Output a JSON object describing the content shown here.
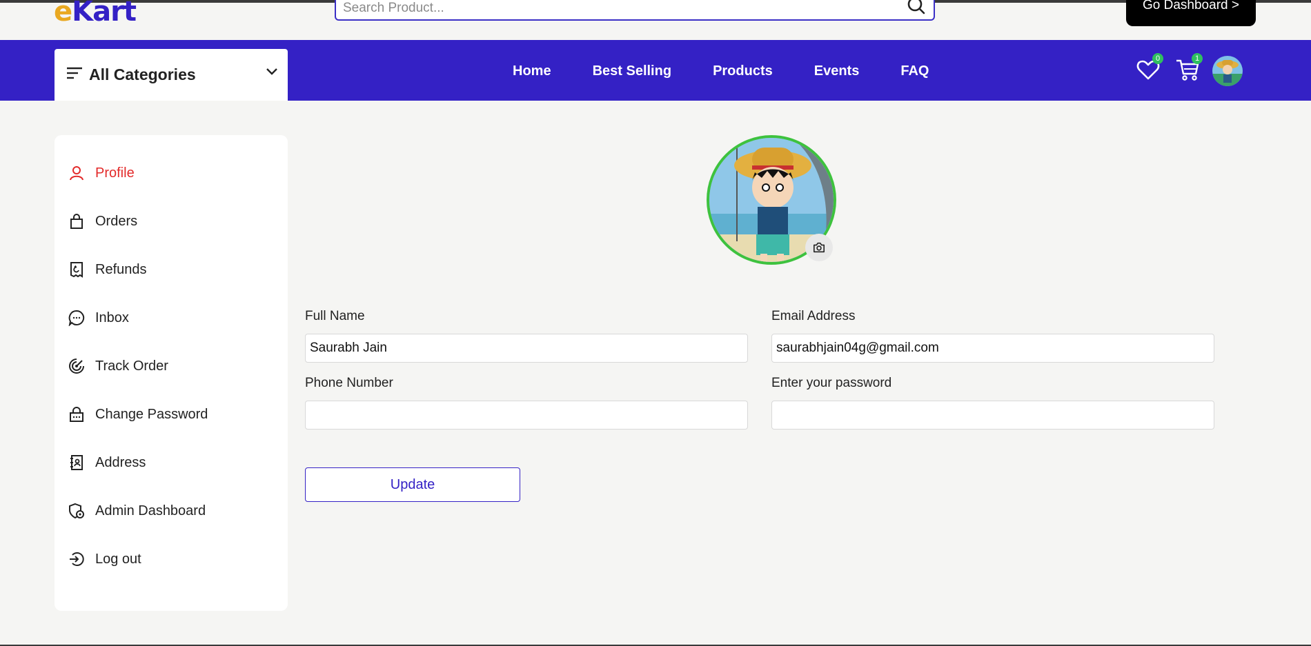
{
  "header": {
    "logo_accent": "e",
    "logo_rest": "Kart",
    "search_placeholder": "Search Product...",
    "dashboard_label": "Go Dashboard >"
  },
  "nav": {
    "categories_label": "All Categories",
    "links": [
      "Home",
      "Best Selling",
      "Products",
      "Events",
      "FAQ"
    ],
    "wishlist_count": "0",
    "cart_count": "1"
  },
  "sidebar": {
    "items": [
      {
        "label": "Profile",
        "icon": "user-icon"
      },
      {
        "label": "Orders",
        "icon": "bag-icon"
      },
      {
        "label": "Refunds",
        "icon": "receipt-refund-icon"
      },
      {
        "label": "Inbox",
        "icon": "chat-bubble-icon"
      },
      {
        "label": "Track Order",
        "icon": "track-icon"
      },
      {
        "label": "Change Password",
        "icon": "lock-icon"
      },
      {
        "label": "Address",
        "icon": "address-book-icon"
      },
      {
        "label": "Admin Dashboard",
        "icon": "admin-icon"
      },
      {
        "label": "Log out",
        "icon": "logout-icon"
      }
    ]
  },
  "form": {
    "full_name_label": "Full Name",
    "full_name_value": "Saurabh Jain",
    "email_label": "Email Address",
    "email_value": "saurabhjain04g@gmail.com",
    "phone_label": "Phone Number",
    "phone_value": "",
    "password_label": "Enter your password",
    "password_value": "",
    "update_label": "Update"
  },
  "colors": {
    "brand": "#3421c5",
    "active": "#e32a2a",
    "avatar_ring": "#3ec23e",
    "badge": "#2fbf5f"
  }
}
